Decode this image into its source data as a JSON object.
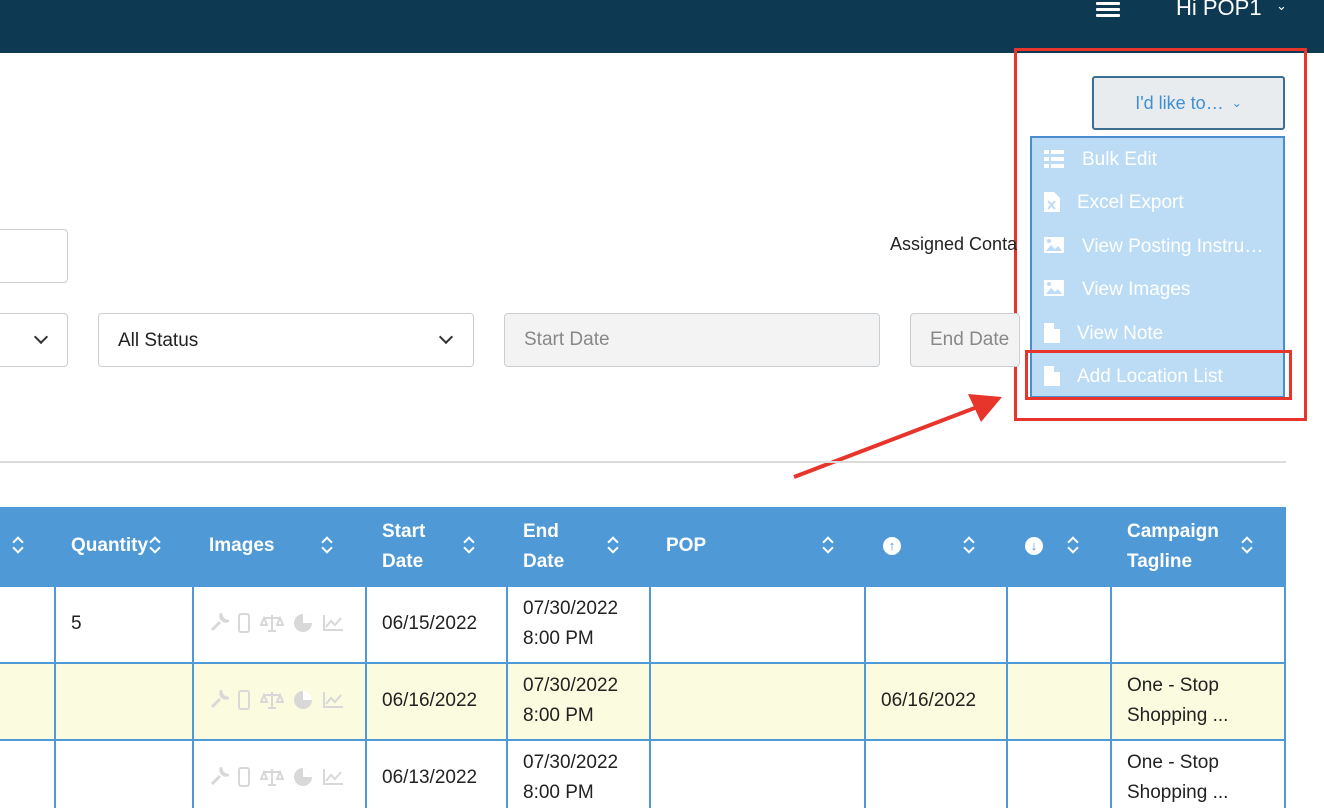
{
  "header": {
    "greeting": "Hi POP1",
    "menu_icon": "hamburger-menu-icon"
  },
  "actions": {
    "button_label": "I'd like to…",
    "menu": [
      {
        "label": "Bulk Edit",
        "icon": "list-icon"
      },
      {
        "label": "Excel Export",
        "icon": "excel-file-icon"
      },
      {
        "label": "View Posting Instru…",
        "icon": "image-icon"
      },
      {
        "label": "View Images",
        "icon": "image-icon"
      },
      {
        "label": "View Note",
        "icon": "file-icon"
      },
      {
        "label": "Add Location List",
        "icon": "file-icon"
      }
    ]
  },
  "filters": {
    "status_value": "All Status",
    "start_date_placeholder": "Start Date",
    "end_date_placeholder": "End Date",
    "assigned_label": "Assigned Conta"
  },
  "table": {
    "columns": [
      "Quantity",
      "Images",
      "Start Date",
      "End Date",
      "POP",
      "",
      "",
      "Campaign Tagline"
    ],
    "rows": [
      {
        "quantity": "5",
        "start_date": "06/15/2022",
        "end_date_1": "07/30/2022",
        "end_date_2": "8:00 PM",
        "pop": "",
        "up_date": "",
        "down_date": "",
        "tagline_1": "",
        "tagline_2": ""
      },
      {
        "quantity": "",
        "start_date": "06/16/2022",
        "end_date_1": "07/30/2022",
        "end_date_2": "8:00 PM",
        "pop": "",
        "up_date": "06/16/2022",
        "down_date": "",
        "tagline_1": "One - Stop",
        "tagline_2": "Shopping ..."
      },
      {
        "quantity": "",
        "start_date": "06/13/2022",
        "end_date_1": "07/30/2022",
        "end_date_2": "8:00 PM",
        "pop": "",
        "up_date": "",
        "down_date": "",
        "tagline_1": "One - Stop",
        "tagline_2": "Shopping ..."
      }
    ]
  },
  "colors": {
    "topbar": "#0d3a52",
    "table_header": "#4f9ad6",
    "dropdown_bg": "#bcdcf5",
    "annotation_red": "#e8352b",
    "highlight_row": "#fbfbdf"
  }
}
